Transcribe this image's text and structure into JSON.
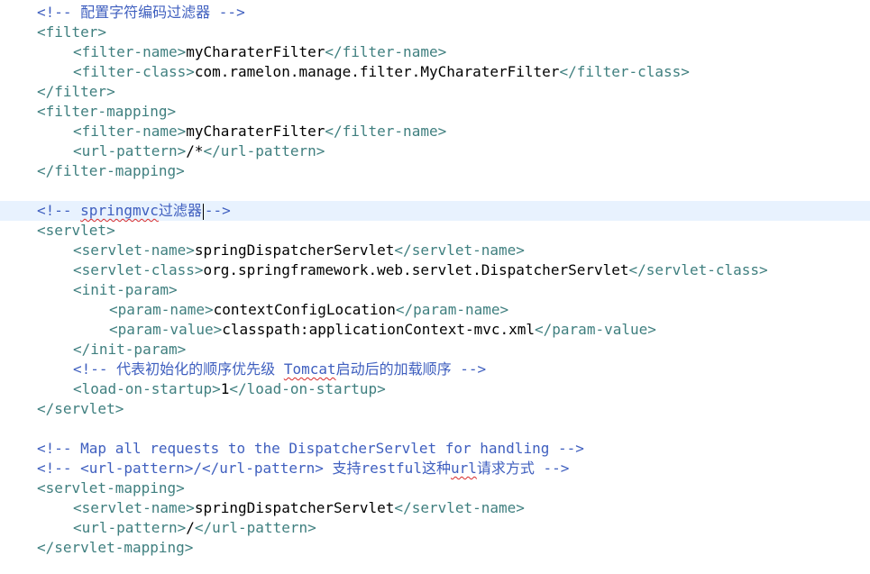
{
  "editor": {
    "indent_unit": "    ",
    "current_line": 10,
    "lines": [
      {
        "indent": 0,
        "tokens": [
          {
            "t": "comment",
            "v": "<!-- 配置字符编码过滤器 -->"
          }
        ]
      },
      {
        "indent": 0,
        "tokens": [
          {
            "t": "tag",
            "v": "<filter>"
          }
        ]
      },
      {
        "indent": 1,
        "tokens": [
          {
            "t": "tag",
            "v": "<filter-name>"
          },
          {
            "t": "text",
            "v": "myCharaterFilter"
          },
          {
            "t": "tag",
            "v": "</filter-name>"
          }
        ]
      },
      {
        "indent": 1,
        "tokens": [
          {
            "t": "tag",
            "v": "<filter-class>"
          },
          {
            "t": "text",
            "v": "com.ramelon.manage.filter.MyCharaterFilter"
          },
          {
            "t": "tag",
            "v": "</filter-class>"
          }
        ]
      },
      {
        "indent": 0,
        "tokens": [
          {
            "t": "tag",
            "v": "</filter>"
          }
        ]
      },
      {
        "indent": 0,
        "tokens": [
          {
            "t": "tag",
            "v": "<filter-mapping>"
          }
        ]
      },
      {
        "indent": 1,
        "tokens": [
          {
            "t": "tag",
            "v": "<filter-name>"
          },
          {
            "t": "text",
            "v": "myCharaterFilter"
          },
          {
            "t": "tag",
            "v": "</filter-name>"
          }
        ]
      },
      {
        "indent": 1,
        "tokens": [
          {
            "t": "tag",
            "v": "<url-pattern>"
          },
          {
            "t": "text",
            "v": "/*"
          },
          {
            "t": "tag",
            "v": "</url-pattern>"
          }
        ]
      },
      {
        "indent": 0,
        "tokens": [
          {
            "t": "tag",
            "v": "</filter-mapping>"
          }
        ]
      },
      {
        "indent": 0,
        "tokens": []
      },
      {
        "indent": 0,
        "tokens": [
          {
            "t": "comment",
            "v": "<!-- "
          },
          {
            "t": "comment-squiggle",
            "v": "springmvc"
          },
          {
            "t": "comment",
            "v": "过滤器"
          },
          {
            "t": "caret",
            "v": ""
          },
          {
            "t": "comment",
            "v": "-->"
          }
        ]
      },
      {
        "indent": 0,
        "tokens": [
          {
            "t": "tag",
            "v": "<servlet>"
          }
        ]
      },
      {
        "indent": 1,
        "tokens": [
          {
            "t": "tag",
            "v": "<servlet-name>"
          },
          {
            "t": "text",
            "v": "springDispatcherServlet"
          },
          {
            "t": "tag",
            "v": "</servlet-name>"
          }
        ]
      },
      {
        "indent": 1,
        "tokens": [
          {
            "t": "tag",
            "v": "<servlet-class>"
          },
          {
            "t": "text",
            "v": "org.springframework.web.servlet.DispatcherServlet"
          },
          {
            "t": "tag",
            "v": "</servlet-class>"
          }
        ]
      },
      {
        "indent": 1,
        "tokens": [
          {
            "t": "tag",
            "v": "<init-param>"
          }
        ]
      },
      {
        "indent": 2,
        "tokens": [
          {
            "t": "tag",
            "v": "<param-name>"
          },
          {
            "t": "text",
            "v": "contextConfigLocation"
          },
          {
            "t": "tag",
            "v": "</param-name>"
          }
        ]
      },
      {
        "indent": 2,
        "tokens": [
          {
            "t": "tag",
            "v": "<param-value>"
          },
          {
            "t": "text",
            "v": "classpath:applicationContext-mvc.xml"
          },
          {
            "t": "tag",
            "v": "</param-value>"
          }
        ]
      },
      {
        "indent": 1,
        "tokens": [
          {
            "t": "tag",
            "v": "</init-param>"
          }
        ]
      },
      {
        "indent": 1,
        "tokens": [
          {
            "t": "comment",
            "v": "<!-- 代表初始化的顺序优先级 "
          },
          {
            "t": "comment-squiggle",
            "v": "Tomcat"
          },
          {
            "t": "comment",
            "v": "启动后的加载顺序 -->"
          }
        ]
      },
      {
        "indent": 1,
        "tokens": [
          {
            "t": "tag",
            "v": "<load-on-startup>"
          },
          {
            "t": "text",
            "v": "1"
          },
          {
            "t": "tag",
            "v": "</load-on-startup>"
          }
        ]
      },
      {
        "indent": 0,
        "tokens": [
          {
            "t": "tag",
            "v": "</servlet>"
          }
        ]
      },
      {
        "indent": 0,
        "tokens": []
      },
      {
        "indent": 0,
        "tokens": [
          {
            "t": "comment",
            "v": "<!-- Map all requests to the DispatcherServlet for handling -->"
          }
        ]
      },
      {
        "indent": 0,
        "tokens": [
          {
            "t": "comment",
            "v": "<!-- <url-pattern>/</url-pattern> 支持restful这种"
          },
          {
            "t": "comment-squiggle",
            "v": "url"
          },
          {
            "t": "comment",
            "v": "请求方式 -->"
          }
        ]
      },
      {
        "indent": 0,
        "tokens": [
          {
            "t": "tag",
            "v": "<servlet-mapping>"
          }
        ]
      },
      {
        "indent": 1,
        "tokens": [
          {
            "t": "tag",
            "v": "<servlet-name>"
          },
          {
            "t": "text",
            "v": "springDispatcherServlet"
          },
          {
            "t": "tag",
            "v": "</servlet-name>"
          }
        ]
      },
      {
        "indent": 1,
        "tokens": [
          {
            "t": "tag",
            "v": "<url-pattern>"
          },
          {
            "t": "text",
            "v": "/"
          },
          {
            "t": "tag",
            "v": "</url-pattern>"
          }
        ]
      },
      {
        "indent": 0,
        "tokens": [
          {
            "t": "tag",
            "v": "</servlet-mapping>"
          }
        ]
      }
    ]
  },
  "colors": {
    "comment": "#3f5fbf",
    "tag": "#3f7f7f",
    "text": "#000000",
    "current_line": "#e8f2fe",
    "squiggle": "#d82a2a"
  }
}
